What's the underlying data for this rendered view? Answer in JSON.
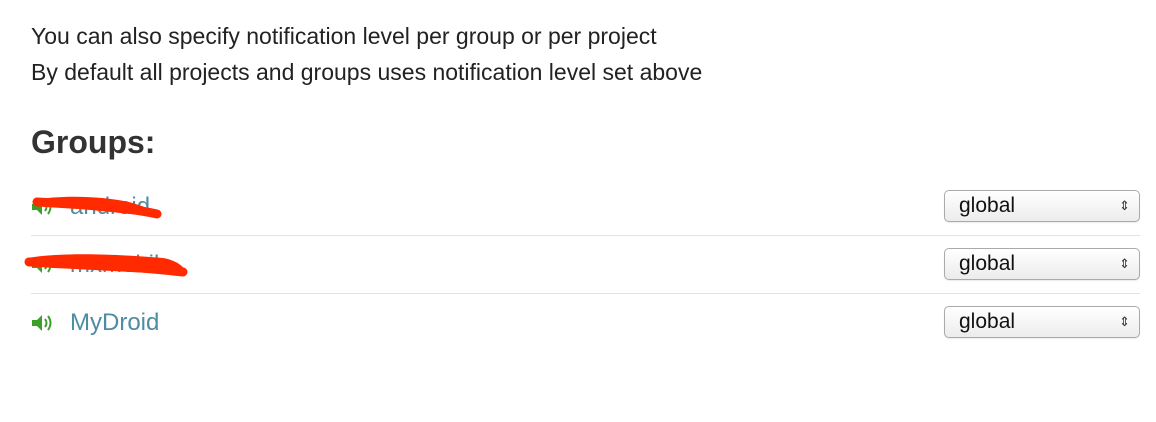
{
  "intro": {
    "line1": "You can also specify notification level per group or per project",
    "line2": "By default all projects and groups uses notification level set above"
  },
  "groups": {
    "heading": "Groups:",
    "items": [
      {
        "name": "android",
        "level": "global",
        "icon": "speaker-volume-icon",
        "redacted": true
      },
      {
        "name": "mxmobile",
        "level": "global",
        "icon": "speaker-volume-icon",
        "redacted": true
      },
      {
        "name": "MyDroid",
        "level": "global",
        "icon": "speaker-volume-icon",
        "redacted": false
      }
    ]
  },
  "colors": {
    "link": "#4d8ca3",
    "icon": "#3aa02a",
    "redaction": "#ff2a00",
    "divider": "#e3e3e3"
  }
}
